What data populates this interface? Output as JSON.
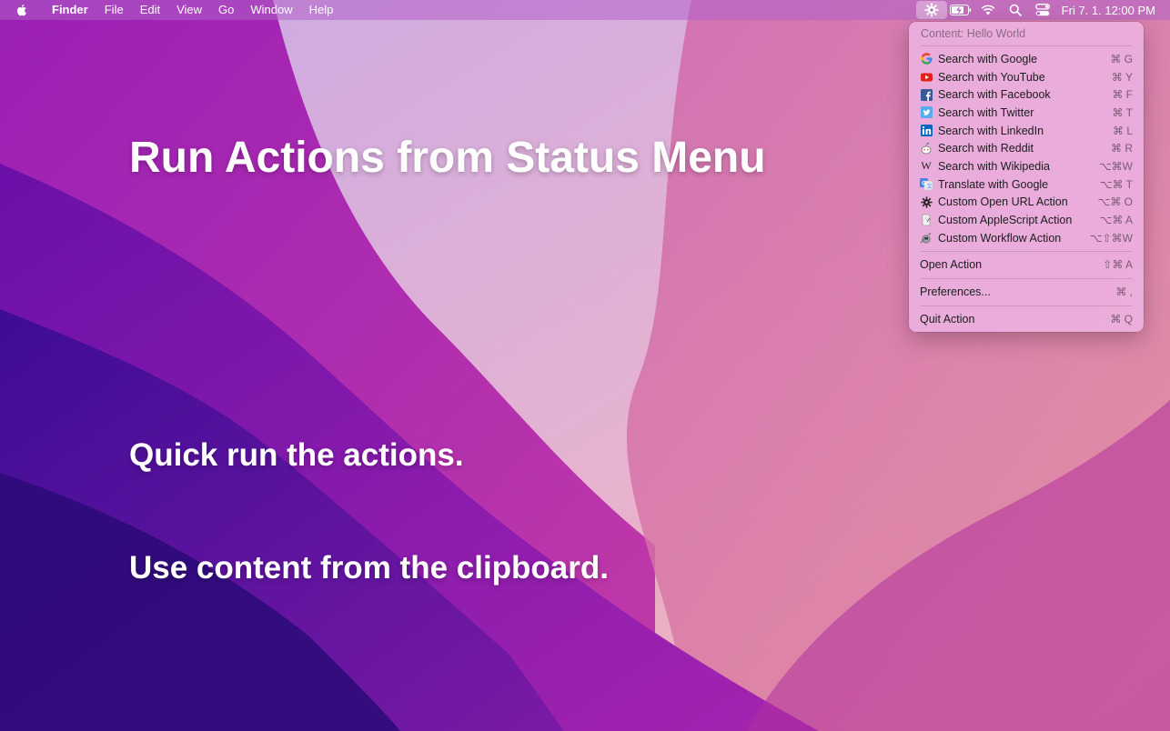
{
  "menubar": {
    "app_name": "Finder",
    "menus": [
      "File",
      "Edit",
      "View",
      "Go",
      "Window",
      "Help"
    ],
    "status_icons": [
      "gear-icon",
      "battery-icon",
      "wifi-icon",
      "search-icon",
      "control-center-icon"
    ],
    "clock": "Fri 7. 1.  12:00 PM"
  },
  "headlines": {
    "title": "Run Actions from Status Menu",
    "line1": "Quick run the actions.",
    "line2": "Use content from the clipboard."
  },
  "dropdown": {
    "content_label": "Content: Hello World",
    "actions": [
      {
        "label": "Search with Google",
        "shortcut": "⌘ G",
        "icon": "google-icon"
      },
      {
        "label": "Search with YouTube",
        "shortcut": "⌘ Y",
        "icon": "youtube-icon"
      },
      {
        "label": "Search with Facebook",
        "shortcut": "⌘ F",
        "icon": "facebook-icon"
      },
      {
        "label": "Search with Twitter",
        "shortcut": "⌘ T",
        "icon": "twitter-icon"
      },
      {
        "label": "Search with LinkedIn",
        "shortcut": "⌘ L",
        "icon": "linkedin-icon"
      },
      {
        "label": "Search with Reddit",
        "shortcut": "⌘ R",
        "icon": "reddit-icon"
      },
      {
        "label": "Search with Wikipedia",
        "shortcut": "⌥⌘W",
        "icon": "wikipedia-icon"
      },
      {
        "label": "Translate with Google",
        "shortcut": "⌥⌘ T",
        "icon": "google-translate-icon"
      },
      {
        "label": "Custom Open URL Action",
        "shortcut": "⌥⌘ O",
        "icon": "gear-icon"
      },
      {
        "label": "Custom AppleScript Action",
        "shortcut": "⌥⌘ A",
        "icon": "applescript-icon"
      },
      {
        "label": "Custom Workflow Action",
        "shortcut": "⌥⇧⌘W",
        "icon": "automator-icon"
      }
    ],
    "open_action": {
      "label": "Open Action",
      "shortcut": "⇧⌘ A"
    },
    "preferences": {
      "label": "Preferences...",
      "shortcut": "⌘ ,"
    },
    "quit": {
      "label": "Quit Action",
      "shortcut": "⌘ Q"
    }
  }
}
